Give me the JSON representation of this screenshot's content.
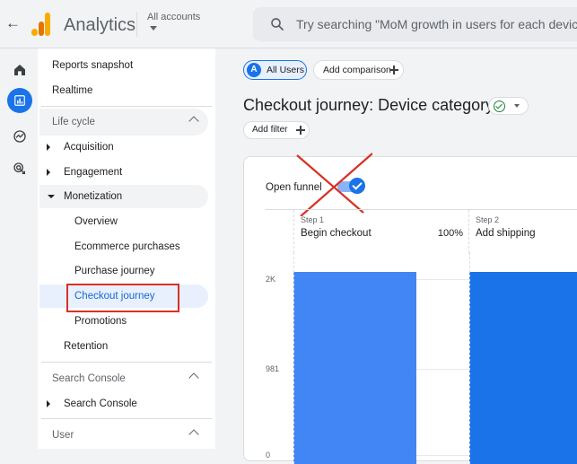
{
  "header": {
    "app_title": "Analytics",
    "account_label": "All accounts",
    "search_placeholder": "Try searching \"MoM growth in users for each device t"
  },
  "rail": {
    "icons": [
      "home-icon",
      "reports-icon",
      "explore-icon",
      "advertising-icon"
    ]
  },
  "nav": {
    "reports_snapshot": "Reports snapshot",
    "realtime": "Realtime",
    "lifecycle": "Life cycle",
    "acquisition": "Acquisition",
    "engagement": "Engagement",
    "monetization": "Monetization",
    "overview": "Overview",
    "ecommerce": "Ecommerce purchases",
    "purchase_journey": "Purchase journey",
    "checkout_journey": "Checkout journey",
    "promotions": "Promotions",
    "retention": "Retention",
    "search_console_section": "Search Console",
    "search_console_item": "Search Console",
    "user_section": "User"
  },
  "main": {
    "segment_badge": "A",
    "segment_label": "All Users",
    "add_comparison": "Add comparison",
    "page_title": "Checkout journey: Device category",
    "add_filter": "Add filter",
    "open_funnel": "Open funnel"
  },
  "chart_data": {
    "type": "bar",
    "steps": [
      {
        "step": "Step 1",
        "name": "Begin checkout",
        "percent": "100%"
      },
      {
        "step": "Step 2",
        "name": "Add shipping",
        "percent": ""
      }
    ],
    "categories": [
      "Begin checkout",
      "Add shipping"
    ],
    "values": [
      2000,
      2000
    ],
    "y_ticks": [
      "2K",
      "981",
      "0"
    ],
    "ylim": [
      0,
      2200
    ],
    "colors": [
      "#4285f4",
      "#1a73e8"
    ]
  }
}
